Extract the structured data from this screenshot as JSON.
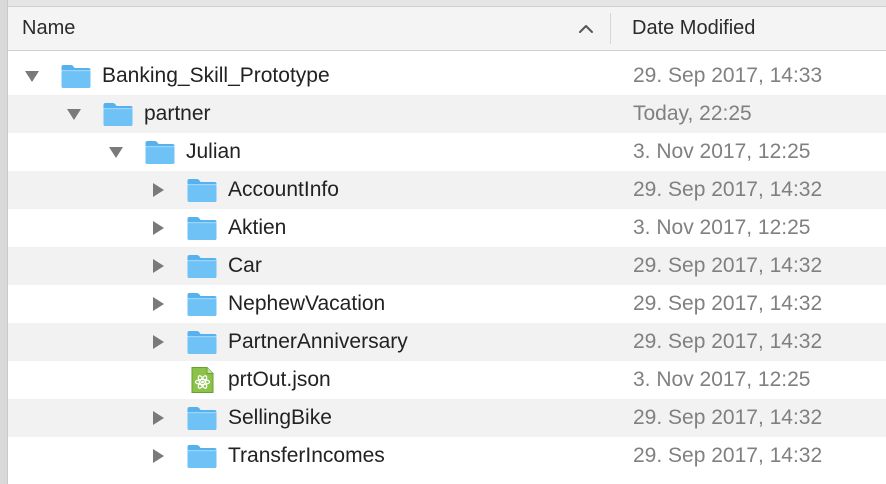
{
  "columns": {
    "name": "Name",
    "date_modified": "Date Modified"
  },
  "colors": {
    "folder": "#6fc2f5",
    "folder_tab": "#55b2ee",
    "alt_row": "#f2f2f2",
    "date_text": "#808080"
  },
  "rows": [
    {
      "name": "Banking_Skill_Prototype",
      "date": "29. Sep 2017, 14:33",
      "depth": 0,
      "kind": "folder",
      "expanded": true,
      "icon": "folder-icon"
    },
    {
      "name": "partner",
      "date": "Today, 22:25",
      "depth": 1,
      "kind": "folder",
      "expanded": true,
      "icon": "folder-icon"
    },
    {
      "name": "Julian",
      "date": "3. Nov 2017, 12:25",
      "depth": 2,
      "kind": "folder",
      "expanded": true,
      "icon": "folder-icon"
    },
    {
      "name": "AccountInfo",
      "date": "29. Sep 2017, 14:32",
      "depth": 3,
      "kind": "folder",
      "expanded": false,
      "icon": "folder-icon"
    },
    {
      "name": "Aktien",
      "date": "3. Nov 2017, 12:25",
      "depth": 3,
      "kind": "folder",
      "expanded": false,
      "icon": "folder-icon"
    },
    {
      "name": "Car",
      "date": "29. Sep 2017, 14:32",
      "depth": 3,
      "kind": "folder",
      "expanded": false,
      "icon": "folder-icon"
    },
    {
      "name": "NephewVacation",
      "date": "29. Sep 2017, 14:32",
      "depth": 3,
      "kind": "folder",
      "expanded": false,
      "icon": "folder-icon"
    },
    {
      "name": "PartnerAnniversary",
      "date": "29. Sep 2017, 14:32",
      "depth": 3,
      "kind": "folder",
      "expanded": false,
      "icon": "folder-icon"
    },
    {
      "name": "prtOut.json",
      "date": "3. Nov 2017, 12:25",
      "depth": 3,
      "kind": "file",
      "expanded": false,
      "icon": "json-file-icon"
    },
    {
      "name": "SellingBike",
      "date": "29. Sep 2017, 14:32",
      "depth": 3,
      "kind": "folder",
      "expanded": false,
      "icon": "folder-icon"
    },
    {
      "name": "TransferIncomes",
      "date": "29. Sep 2017, 14:32",
      "depth": 3,
      "kind": "folder",
      "expanded": false,
      "icon": "folder-icon"
    }
  ]
}
